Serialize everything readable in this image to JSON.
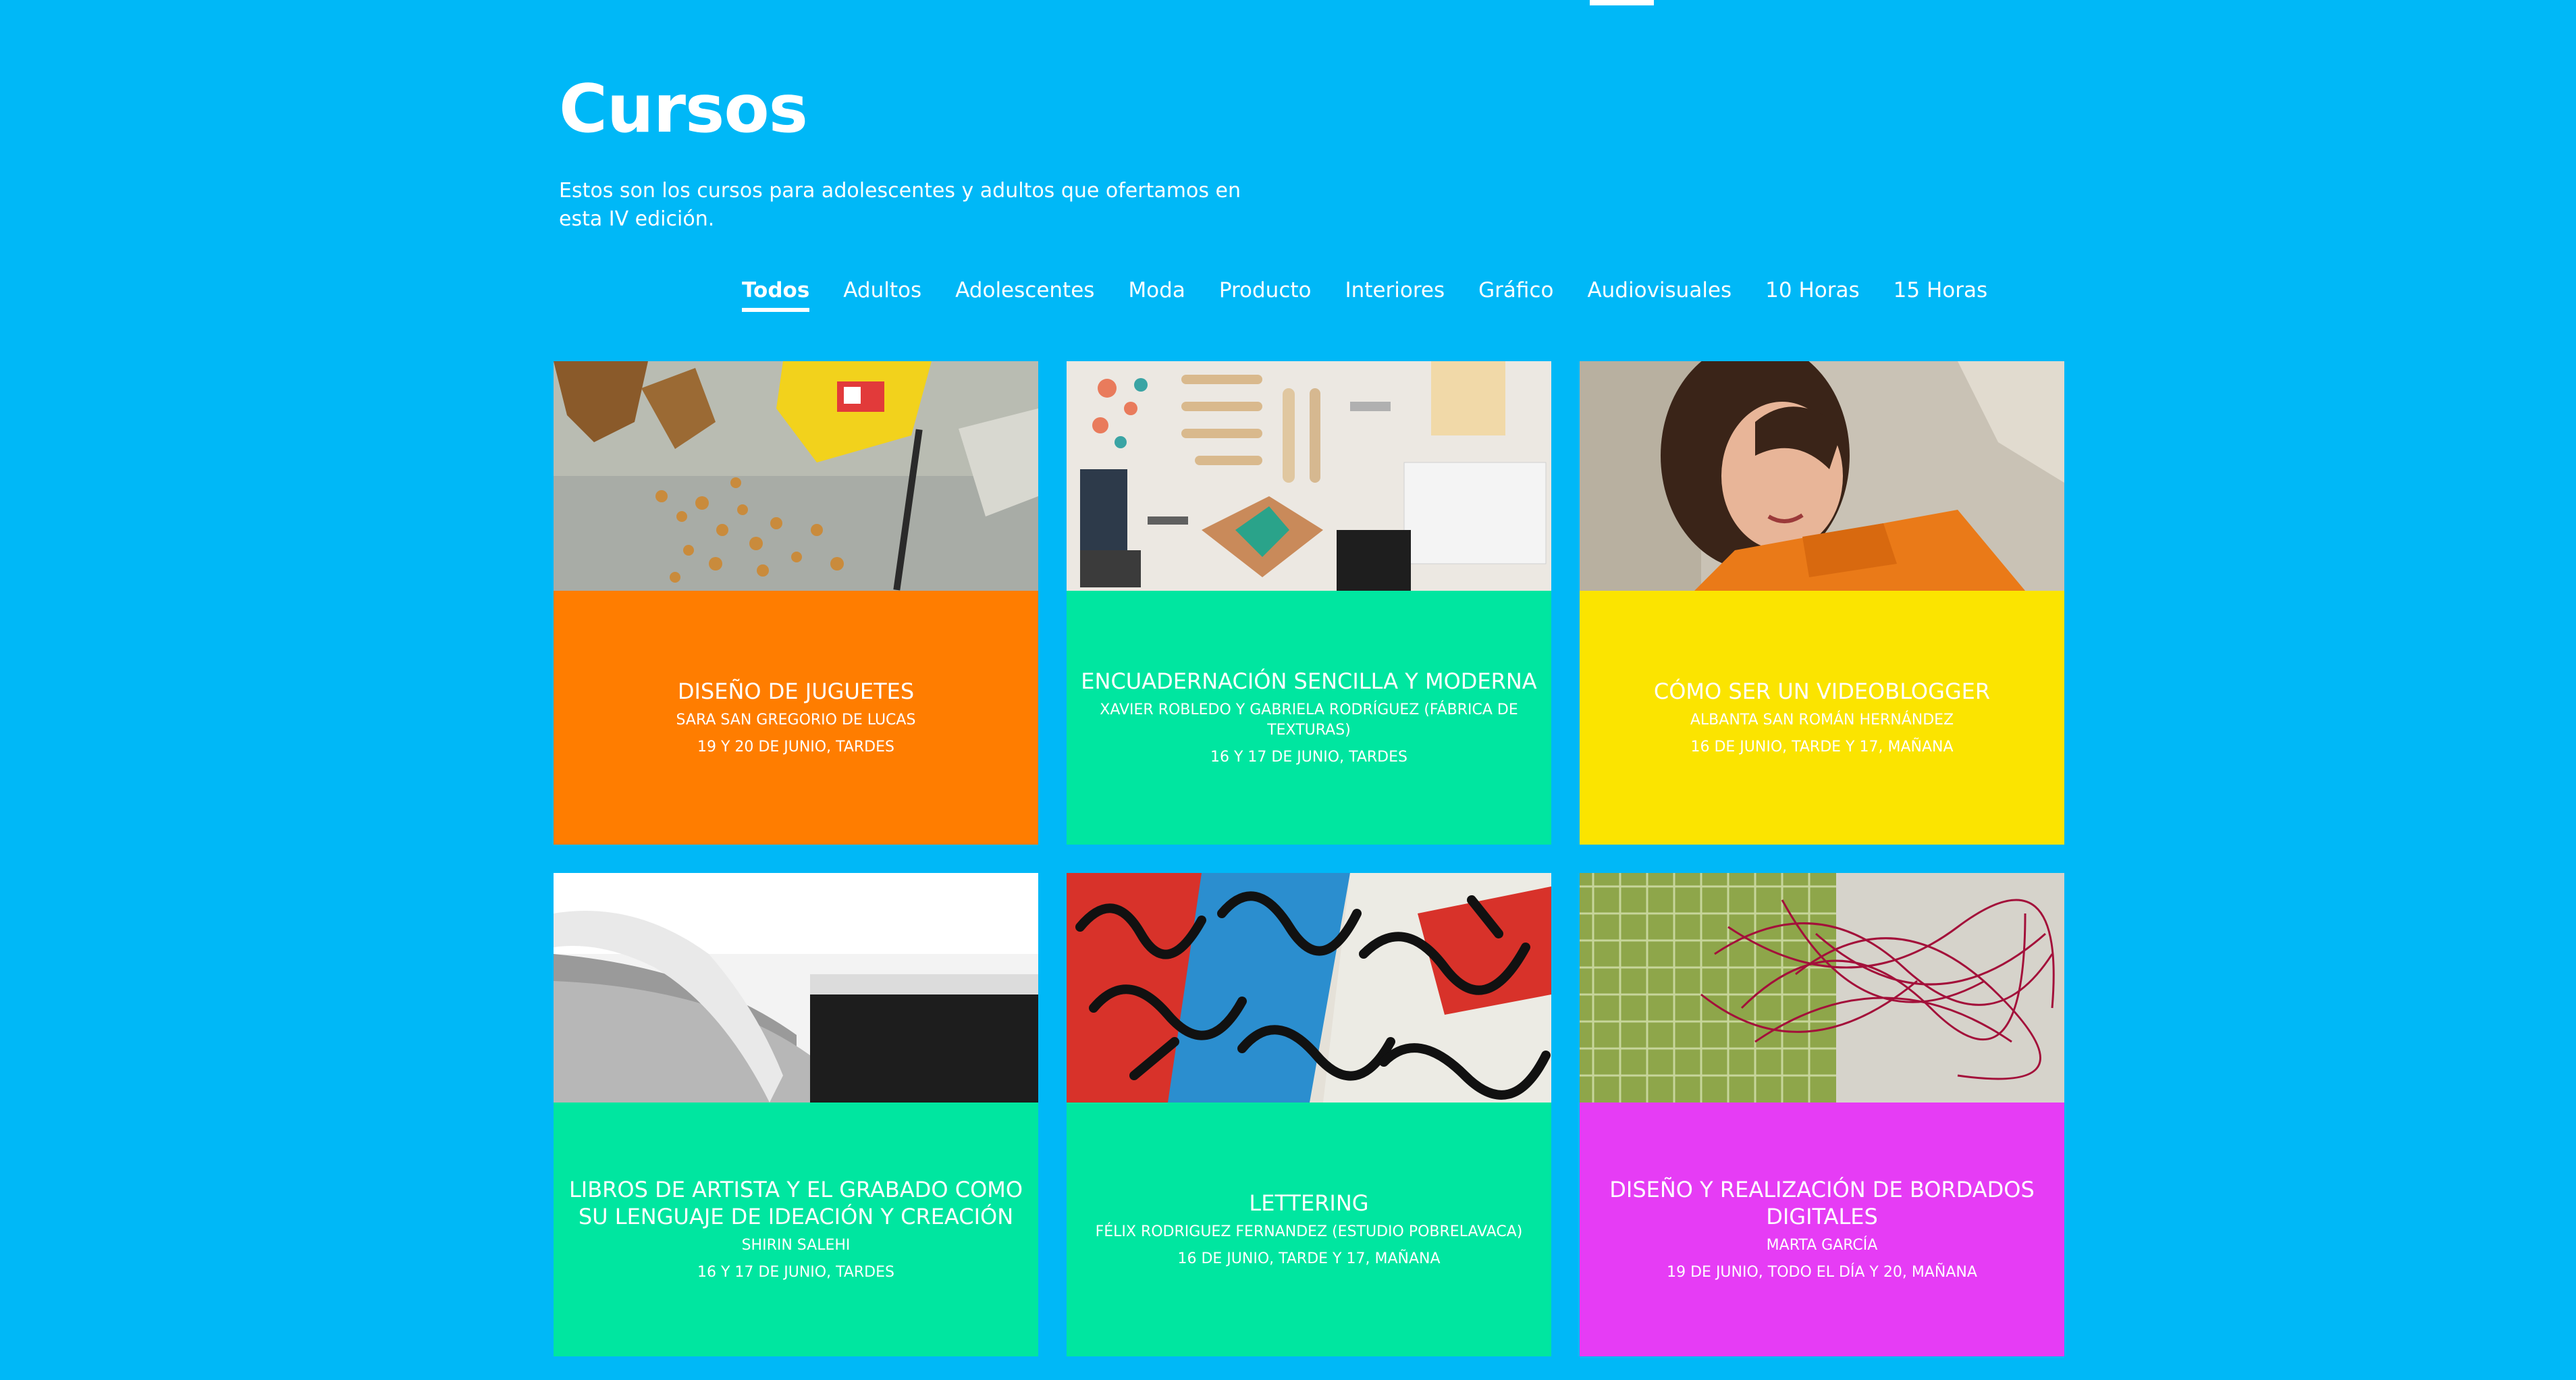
{
  "page": {
    "title": "Cursos",
    "intro": "Estos son los cursos para adolescentes y adultos que ofertamos en esta IV edición."
  },
  "filters": [
    {
      "label": "Todos",
      "active": true
    },
    {
      "label": "Adultos"
    },
    {
      "label": "Adolescentes"
    },
    {
      "label": "Moda"
    },
    {
      "label": "Producto"
    },
    {
      "label": "Interiores"
    },
    {
      "label": "Gráfico"
    },
    {
      "label": "Audiovisuales"
    },
    {
      "label": "10 Horas"
    },
    {
      "label": "15 Horas"
    }
  ],
  "colors": {
    "background": "#00b8f7",
    "orange": "#ff7d00",
    "green": "#00e6a0",
    "yellow": "#fbe400",
    "magenta": "#e63cf5"
  },
  "courses": [
    {
      "title": "Diseño de juguetes",
      "author": "Sara San Gregorio de Lucas",
      "dates": "19 y 20 de junio, tardes",
      "color": "#ff7d00",
      "image": "wooden-puzzle-pieces-photo"
    },
    {
      "title": "Encuadernación sencilla y moderna",
      "author": "Xavier Robledo y Gabriela Rodríguez (Fábrica de texturas)",
      "dates": "16 y 17 de junio, tardes",
      "color": "#00e6a0",
      "image": "bookbinding-tools-photo"
    },
    {
      "title": "Cómo ser un videoblogger",
      "author": "Albanta San Román Hernández",
      "dates": "16 de junio, tarde y 17, mañana",
      "color": "#fbe400",
      "image": "smiling-woman-photo"
    },
    {
      "title": "Libros de artista y el grabado como su lenguaje de ideación y creación",
      "author": "Shirin Salehi",
      "dates": "16 y 17 de junio, tardes",
      "color": "#00e6a0",
      "image": "open-book-pages-photo"
    },
    {
      "title": "Lettering",
      "author": "Félix Rodriguez Fernandez (Estudio Pobrelavaca)",
      "dates": "16 de junio, tarde y 17, mañana",
      "color": "#00e6a0",
      "image": "calligraphy-artwork-photo"
    },
    {
      "title": "Diseño y realización de bordados digitales",
      "author": "Marta García",
      "dates": "19 de junio, todo el día y 20, mañana",
      "color": "#e63cf5",
      "image": "embroidery-threads-photo"
    }
  ]
}
